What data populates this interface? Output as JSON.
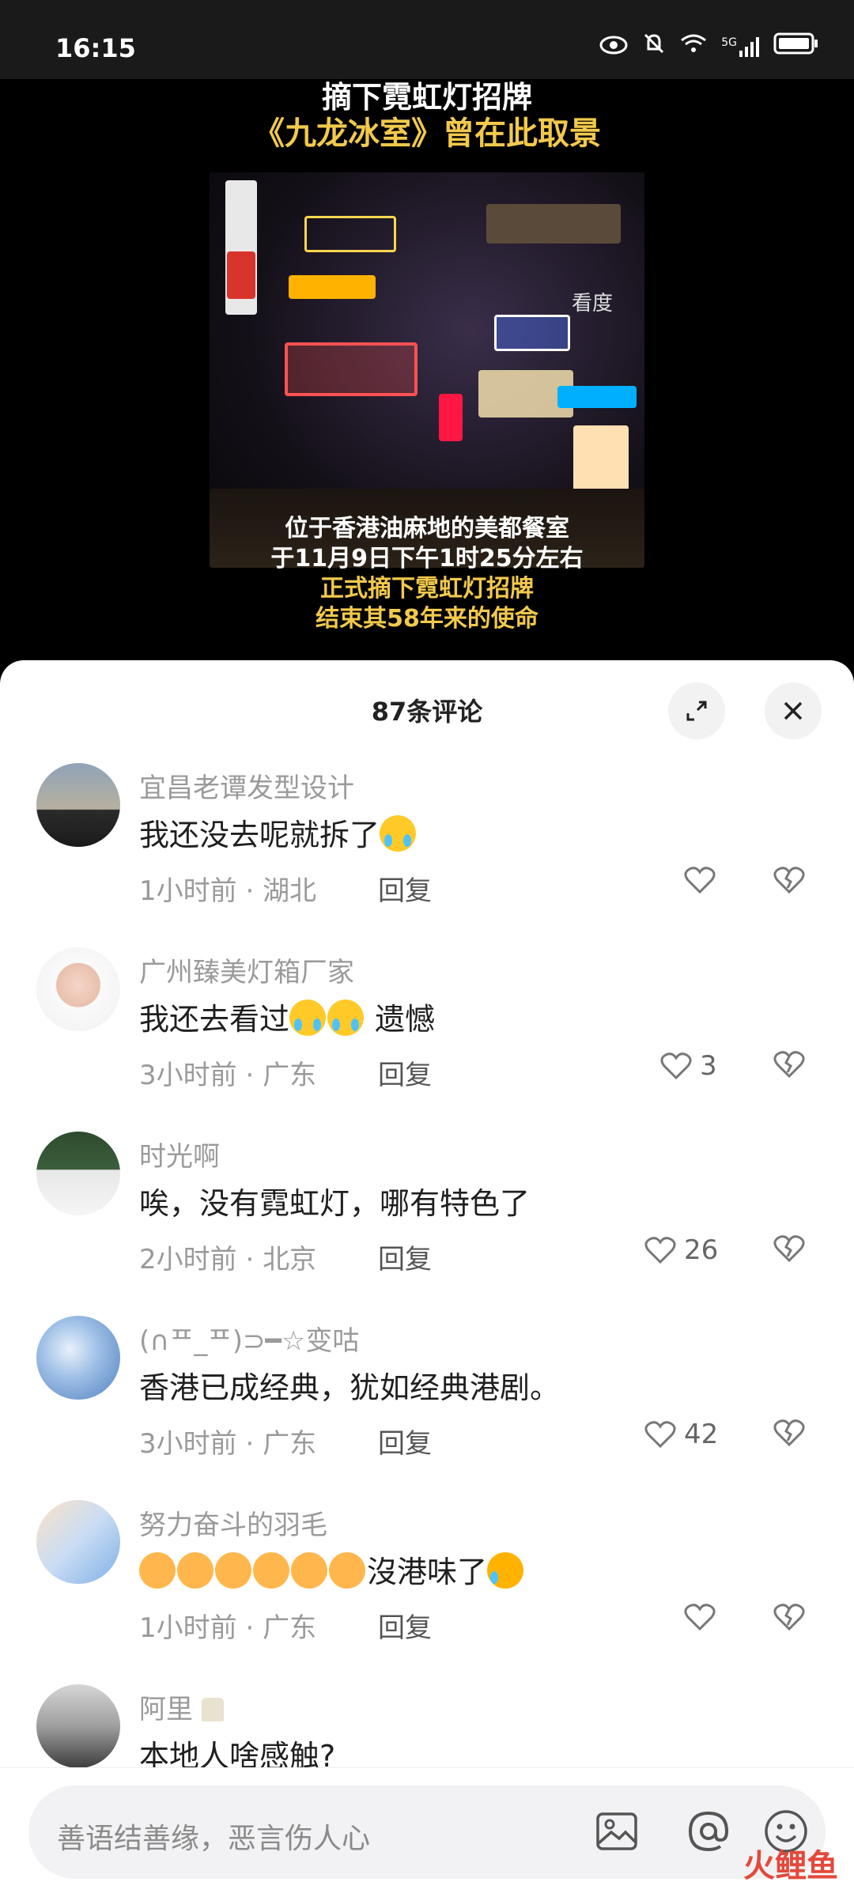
{
  "status": {
    "time": "16:15",
    "network": "5G"
  },
  "video": {
    "caption_top_1": "摘下霓虹灯招牌",
    "caption_top_2": "《九龙冰室》曾在此取景",
    "watermark": "看度",
    "caption_bottom_1": "位于香港油麻地的美都餐室",
    "caption_bottom_2": "于11月9日下午1时25分左右",
    "caption_bottom_3": "正式摘下霓虹灯招牌",
    "caption_bottom_4": "结束其58年来的使命"
  },
  "sheet": {
    "title": "87条评论",
    "expand_icon": "expand-icon",
    "close_icon": "close-icon"
  },
  "comments": [
    {
      "user": "宜昌老谭发型设计",
      "text": "我还没去呢就拆了",
      "time": "1小时前",
      "region": "湖北",
      "reply": "回复",
      "likes": ""
    },
    {
      "user": "广州臻美灯箱厂家",
      "text": "我还去看过",
      "text2": "遗憾",
      "time": "3小时前",
      "region": "广东",
      "reply": "回复",
      "likes": "3"
    },
    {
      "user": "时光啊",
      "text": "唉，没有霓虹灯，哪有特色了",
      "time": "2小时前",
      "region": "北京",
      "reply": "回复",
      "likes": "26"
    },
    {
      "user": "(∩ᄑ_ᄑ)⊃━☆变咕",
      "text": "香港已成经典，犹如经典港剧。",
      "time": "3小时前",
      "region": "广东",
      "reply": "回复",
      "likes": "42"
    },
    {
      "user": "努力奋斗的羽毛",
      "text": "沒港味了",
      "time": "1小时前",
      "region": "广东",
      "reply": "回复",
      "likes": ""
    },
    {
      "user": "阿里",
      "text": "本地人啥感触?"
    }
  ],
  "input": {
    "placeholder": "善语结善缘，恶言伤人心",
    "icons": [
      "image-icon",
      "at-icon",
      "emoji-icon"
    ]
  },
  "brand": "火鲤鱼"
}
